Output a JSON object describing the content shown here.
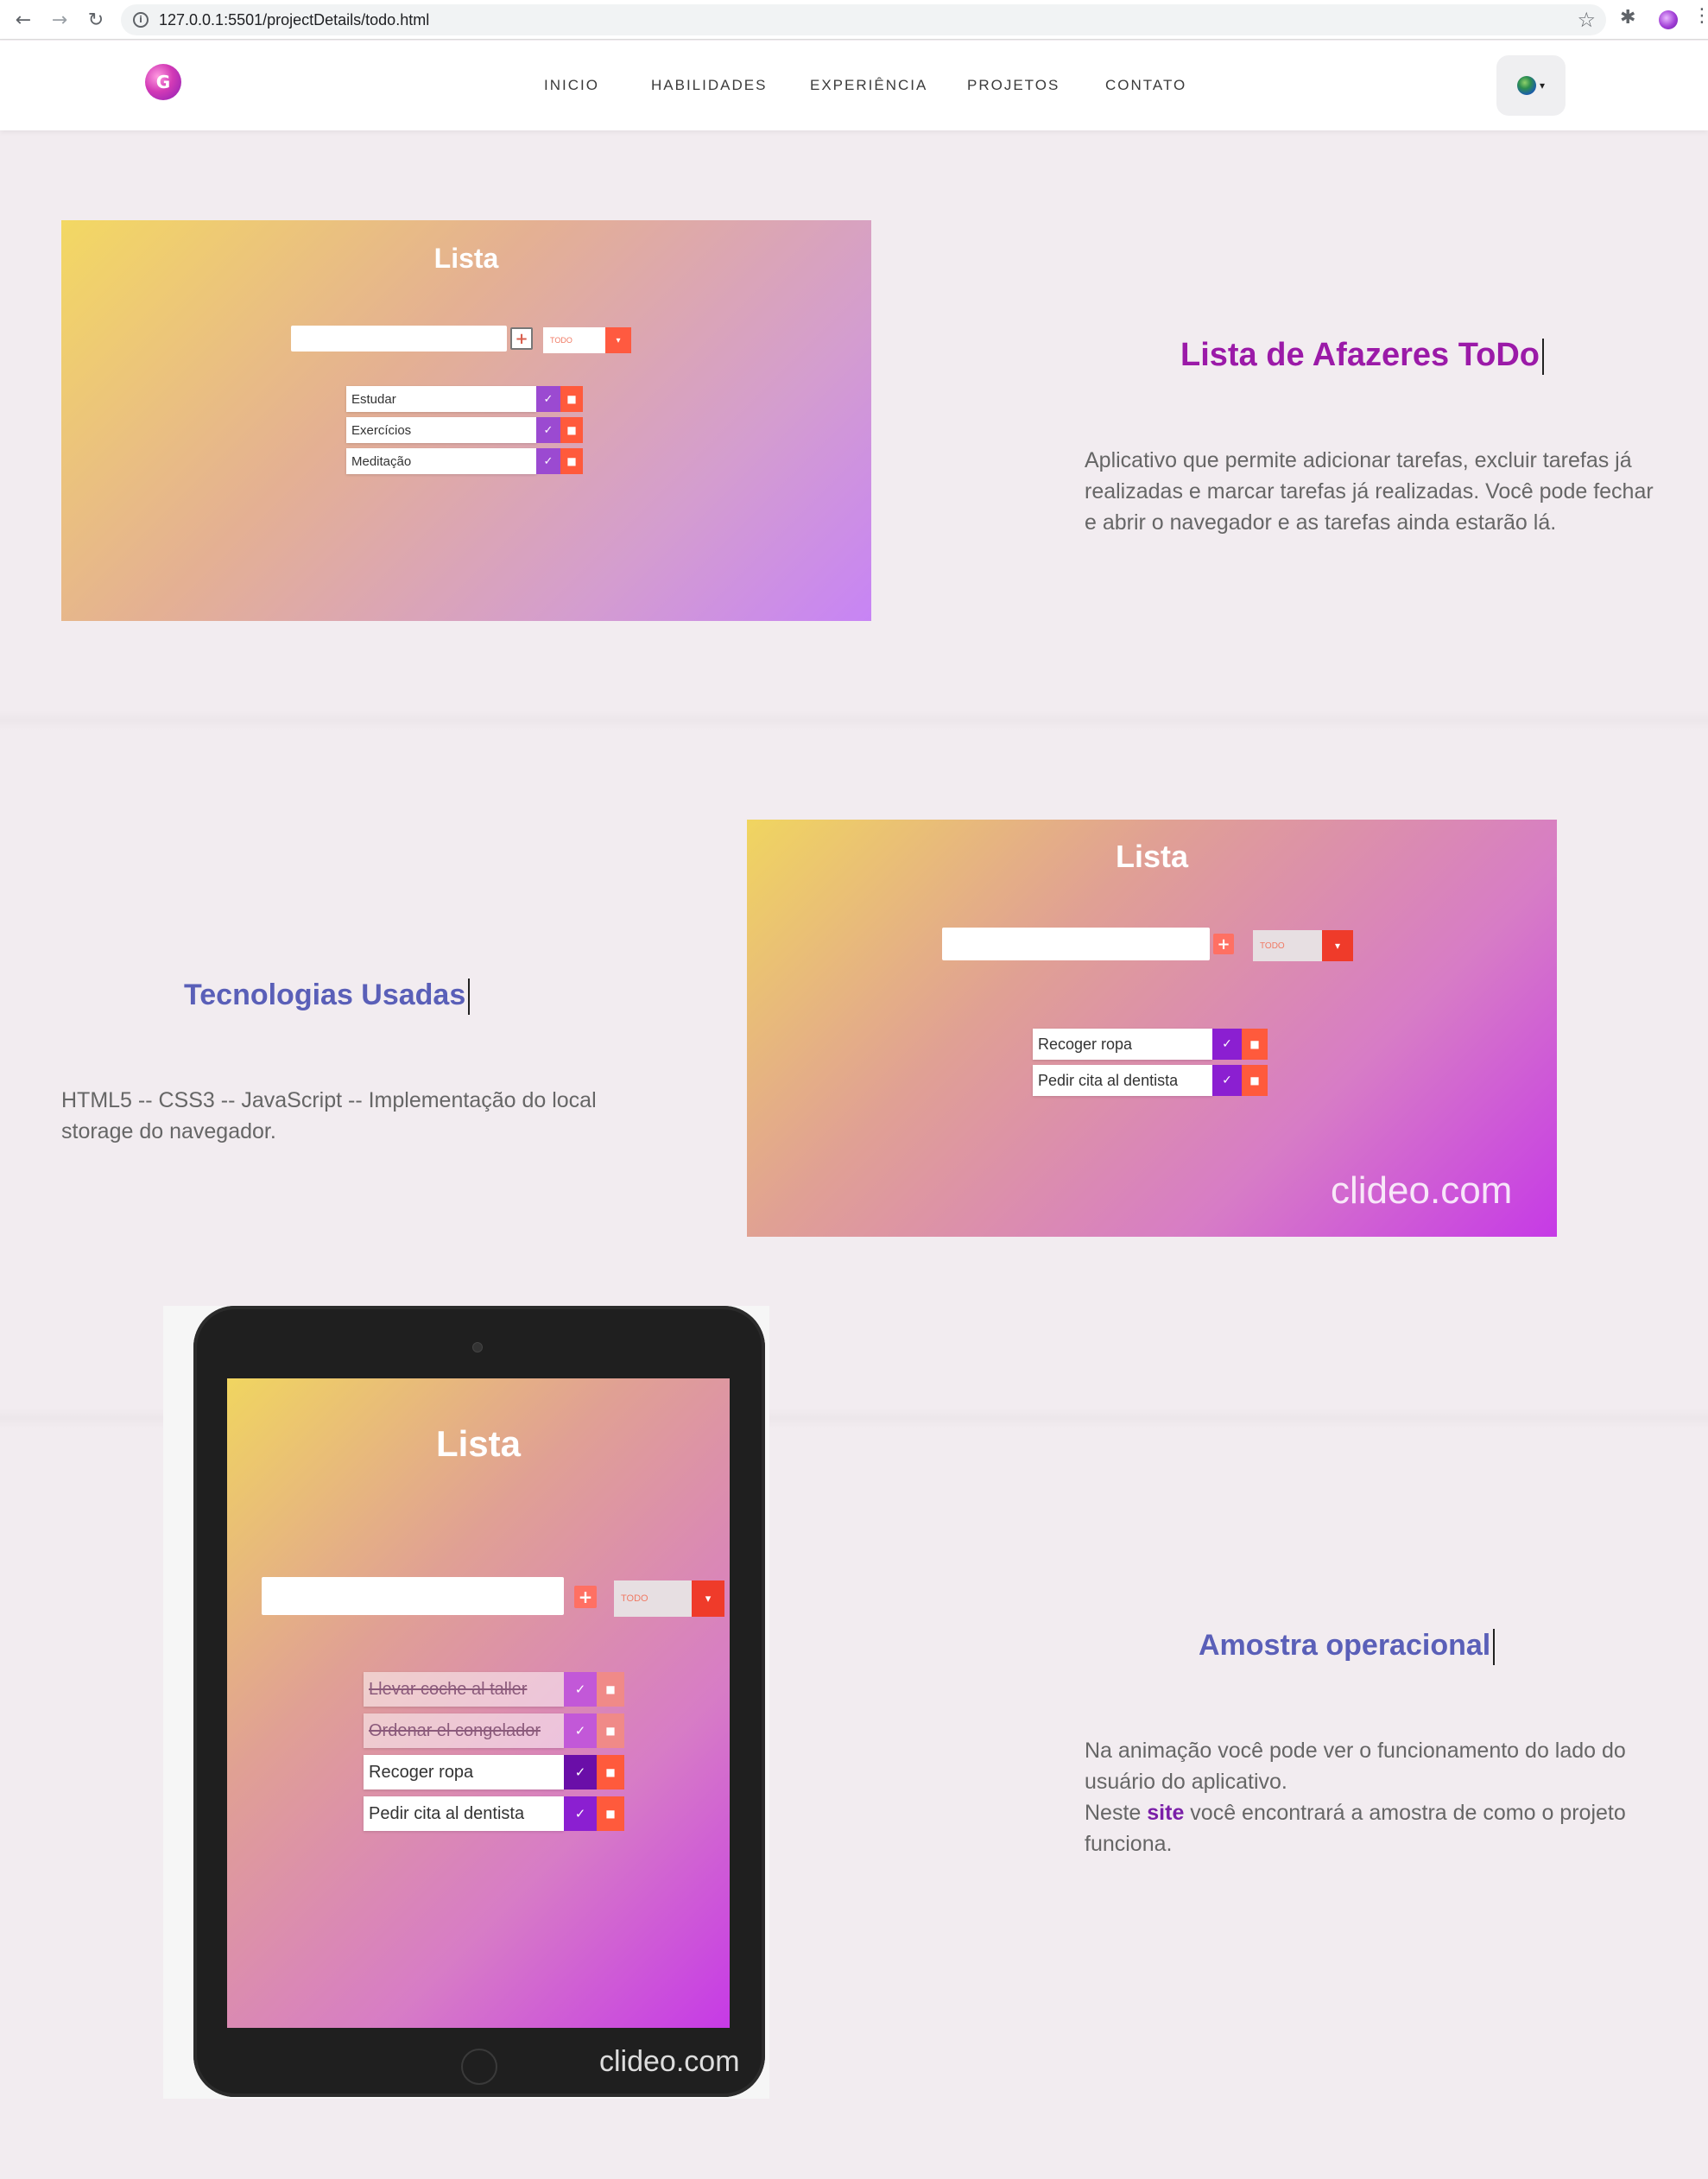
{
  "browser": {
    "url": "127.0.0.1:5501/projectDetails/todo.html"
  },
  "header": {
    "logo_letter": "G",
    "nav": [
      "INICIO",
      "HABILIDADES",
      "EXPERIÊNCIA",
      "PROJETOS",
      "CONTATO"
    ],
    "lang_caret": "▾"
  },
  "section1": {
    "title": "Lista de Afazeres ToDo",
    "title_color": "#9b1aa8",
    "description": "Aplicativo que permite adicionar tarefas, excluir tarefas já realizadas e marcar tarefas já realizadas. Você pode fechar e abrir o navegador e as tarefas ainda estarão lá.",
    "mockup": {
      "heading": "Lista",
      "select": "TODO",
      "tasks": [
        "Estudar",
        "Exercícios",
        "Meditação"
      ]
    }
  },
  "section2": {
    "title": "Tecnologias Usadas",
    "title_color": "#5a5fb8",
    "description": "HTML5 -- CSS3 -- JavaScript -- Implementação do local storage do navegador.",
    "mockup": {
      "heading": "Lista",
      "select": "TODO",
      "tasks": [
        "Recoger ropa",
        "Pedir cita al dentista"
      ],
      "watermark": "clideo.com"
    }
  },
  "section3": {
    "title": "Amostra operacional",
    "title_color": "#5a5fb8",
    "description_part1": "Na animação você pode ver o funcionamento do lado do usuário do aplicativo.",
    "description_part2_pre": "Neste ",
    "link_text": "site",
    "description_part2_post": " você encontrará a amostra de como o projeto funciona.",
    "mockup": {
      "heading": "Lista",
      "select": "TODO",
      "tasks_done": [
        "Llevar coche al taller",
        "Ordenar el congelador"
      ],
      "tasks": [
        "Recoger ropa",
        "Pedir cita al dentista"
      ],
      "watermark": "clideo.com"
    }
  }
}
